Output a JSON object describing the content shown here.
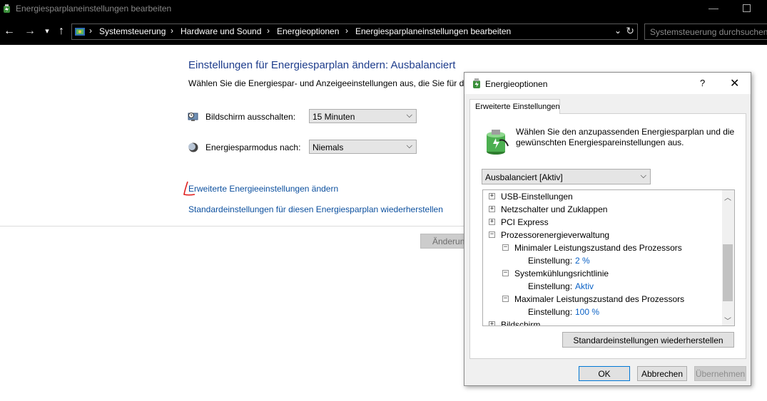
{
  "window": {
    "title": "Energiesparplaneinstellungen bearbeiten"
  },
  "address": {
    "crumbs": [
      "Systemsteuerung",
      "Hardware und Sound",
      "Energieoptionen",
      "Energiesparplaneinstellungen bearbeiten"
    ],
    "search_placeholder": "Systemsteuerung durchsuchen"
  },
  "main": {
    "title": "Einstellungen für Energiesparplan ändern: Ausbalanciert",
    "description": "Wählen Sie die Energiespar- und Anzeigeeinstellungen aus, die Sie für den",
    "screen_off_label": "Bildschirm ausschalten:",
    "screen_off_value": "15 Minuten",
    "sleep_label": "Energiesparmodus nach:",
    "sleep_value": "Niemals",
    "advanced_link": "Erweiterte Energieeinstellungen ändern",
    "restore_link": "Standardeinstellungen für diesen Energiesparplan wiederherstellen",
    "apply_button": "Änderungen speichern"
  },
  "dialog": {
    "title": "Energieoptionen",
    "help": "?",
    "tab": "Erweiterte Einstellungen",
    "description": "Wählen Sie den anzupassenden Energiesparplan und die gewünschten Energiespareinstellungen aus.",
    "plan_value": "Ausbalanciert [Aktiv]",
    "tree": [
      {
        "box": "+",
        "text": "USB-Einstellungen"
      },
      {
        "box": "+",
        "text": "Netzschalter und Zuklappen"
      },
      {
        "box": "+",
        "text": "PCI Express"
      },
      {
        "box": "−",
        "text": "Prozessorenergieverwaltung"
      },
      {
        "box": "−",
        "text": "Minimaler Leistungszustand des Prozessors"
      },
      {
        "label": "Einstellung:",
        "value": "2 %"
      },
      {
        "box": "−",
        "text": "Systemkühlungsrichtlinie"
      },
      {
        "label": "Einstellung:",
        "value": "Aktiv"
      },
      {
        "box": "−",
        "text": "Maximaler Leistungszustand des Prozessors"
      },
      {
        "label": "Einstellung:",
        "value": "100 %"
      },
      {
        "box": "+",
        "text": "Bildschirm"
      }
    ],
    "restore_button": "Standardeinstellungen wiederherstellen",
    "ok": "OK",
    "cancel": "Abbrechen",
    "apply": "Übernehmen"
  }
}
